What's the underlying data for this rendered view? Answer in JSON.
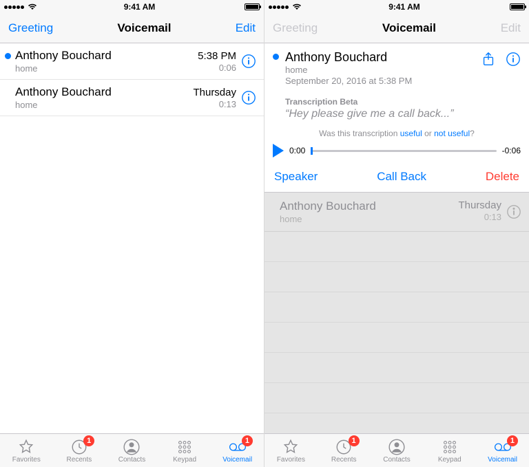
{
  "status": {
    "time": "9:41 AM"
  },
  "nav": {
    "left": "Greeting",
    "title": "Voicemail",
    "right": "Edit"
  },
  "left": {
    "rows": [
      {
        "name": "Anthony Bouchard",
        "label": "home",
        "time": "5:38 PM",
        "duration": "0:06",
        "unread": true
      },
      {
        "name": "Anthony Bouchard",
        "label": "home",
        "time": "Thursday",
        "duration": "0:13",
        "unread": false
      }
    ]
  },
  "right": {
    "expanded": {
      "name": "Anthony Bouchard",
      "label": "home",
      "datetime": "September 20, 2016 at 5:38 PM",
      "transcription_label": "Transcription Beta",
      "transcription_text": "“Hey please give me a call back...”",
      "feedback_prefix": "Was this transcription ",
      "feedback_useful": "useful",
      "feedback_or": " or ",
      "feedback_not_useful": "not useful",
      "feedback_q": "?",
      "elapsed": "0:00",
      "remaining": "-0:06",
      "actions": {
        "speaker": "Speaker",
        "callback": "Call Back",
        "delete": "Delete"
      }
    },
    "other_row": {
      "name": "Anthony Bouchard",
      "label": "home",
      "time": "Thursday",
      "duration": "0:13"
    }
  },
  "tabs": {
    "items": [
      {
        "label": "Favorites",
        "badge": null
      },
      {
        "label": "Recents",
        "badge": "1"
      },
      {
        "label": "Contacts",
        "badge": null
      },
      {
        "label": "Keypad",
        "badge": null
      },
      {
        "label": "Voicemail",
        "badge": "1"
      }
    ]
  }
}
